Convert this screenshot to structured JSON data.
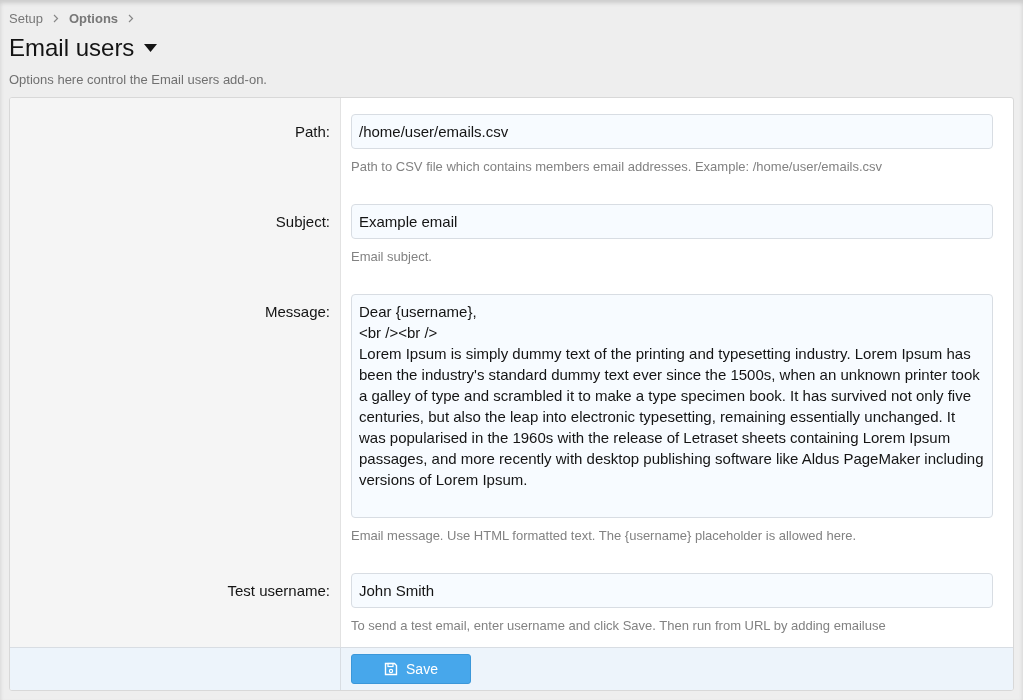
{
  "breadcrumb": [
    {
      "label": "Setup",
      "current": false
    },
    {
      "label": "Options",
      "current": true
    }
  ],
  "title": "Email users",
  "description": "Options here control the Email users add-on.",
  "fields": [
    {
      "kind": "input",
      "label": "Path:",
      "value": "/home/user/emails.csv",
      "hint": "Path to CSV file which contains members email addresses. Example: /home/user/emails.csv"
    },
    {
      "kind": "input",
      "label": "Subject:",
      "value": "Example email",
      "hint": "Email subject."
    },
    {
      "kind": "textarea",
      "label": "Message:",
      "value": "Dear {username},\n<br /><br />\nLorem Ipsum is simply dummy text of the printing and typesetting industry. Lorem Ipsum has been the industry's standard dummy text ever since the 1500s, when an unknown printer took a galley of type and scrambled it to make a type specimen book. It has survived not only five centuries, but also the leap into electronic typesetting, remaining essentially unchanged. It was popularised in the 1960s with the release of Letraset sheets containing Lorem Ipsum passages, and more recently with desktop publishing software like Aldus PageMaker including versions of Lorem Ipsum.",
      "hint": "Email message. Use HTML formatted text. The {username} placeholder is allowed here."
    },
    {
      "kind": "input",
      "label": "Test username:",
      "value": "John Smith",
      "hint": "To send a test email, enter username and click Save. Then run from URL by adding emailuse"
    }
  ],
  "save_button": "Save"
}
